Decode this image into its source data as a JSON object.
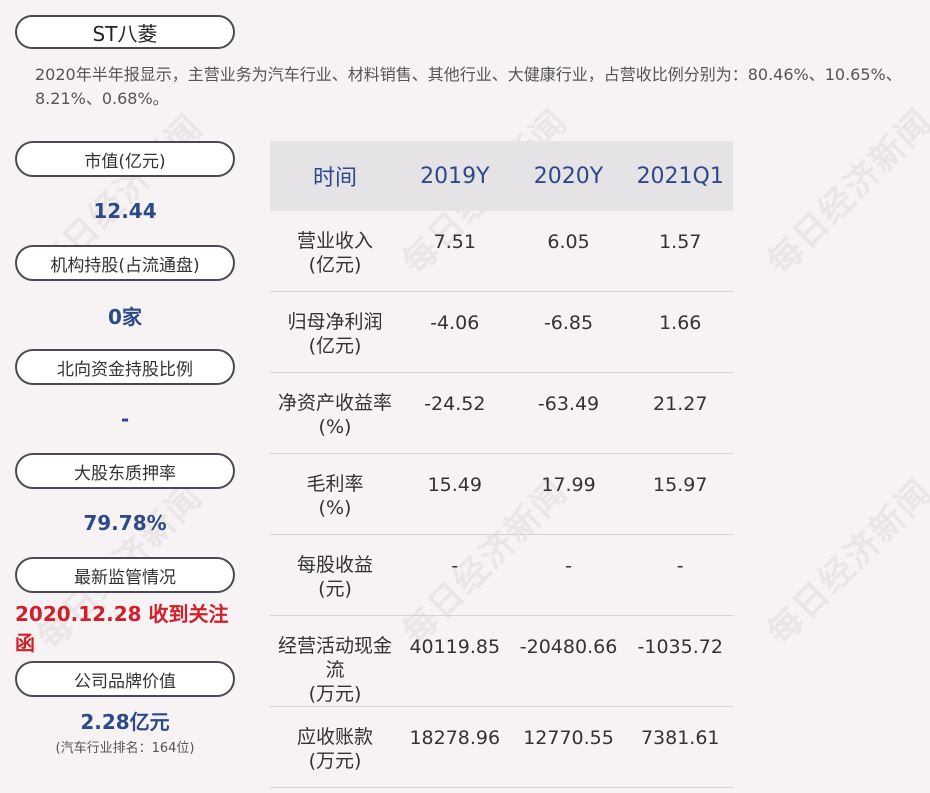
{
  "company": "ST八菱",
  "summary": "2020年半年报显示，主营业务为汽车行业、材料销售、其他行业、大健康行业，占营收比例分别为：80.46%、10.65%、8.21%、0.68%。",
  "watermark": "每日经济新闻",
  "metrics": [
    {
      "label": "市值(亿元)",
      "value": "12.44"
    },
    {
      "label": "机构持股(占流通盘)",
      "value": "0家"
    },
    {
      "label": "北向资金持股比例",
      "value": "-"
    },
    {
      "label": "大股东质押率",
      "value": "79.78%"
    },
    {
      "label": "最新监管情况",
      "value": "2020.12.28 收到关注函"
    },
    {
      "label": "公司品牌价值",
      "value": "2.28亿元",
      "note": "(汽车行业排名：164位)"
    }
  ],
  "colors": {
    "accent_blue": "#2c4a8a",
    "alert_red": "#d0202a",
    "header_bg": "#e6e3e6"
  },
  "table": {
    "headers": [
      "时间",
      "2019Y",
      "2020Y",
      "2021Q1"
    ],
    "rows": [
      {
        "name": "营业收入",
        "unit": "(亿元)",
        "values": [
          "7.51",
          "6.05",
          "1.57"
        ]
      },
      {
        "name": "归母净利润",
        "unit": "(亿元)",
        "values": [
          "-4.06",
          "-6.85",
          "1.66"
        ]
      },
      {
        "name": "净资产收益率",
        "unit": "(%)",
        "values": [
          "-24.52",
          "-63.49",
          "21.27"
        ]
      },
      {
        "name": "毛利率",
        "unit": "(%)",
        "values": [
          "15.49",
          "17.99",
          "15.97"
        ]
      },
      {
        "name": "每股收益",
        "unit": "(元)",
        "values": [
          "-",
          "-",
          "-"
        ]
      },
      {
        "name": "经营活动现金流",
        "unit": "(万元)",
        "values": [
          "40119.85",
          "-20480.66",
          "-1035.72"
        ]
      },
      {
        "name": "应收账款",
        "unit": "(万元)",
        "values": [
          "18278.96",
          "12770.55",
          "7381.61"
        ]
      }
    ]
  }
}
